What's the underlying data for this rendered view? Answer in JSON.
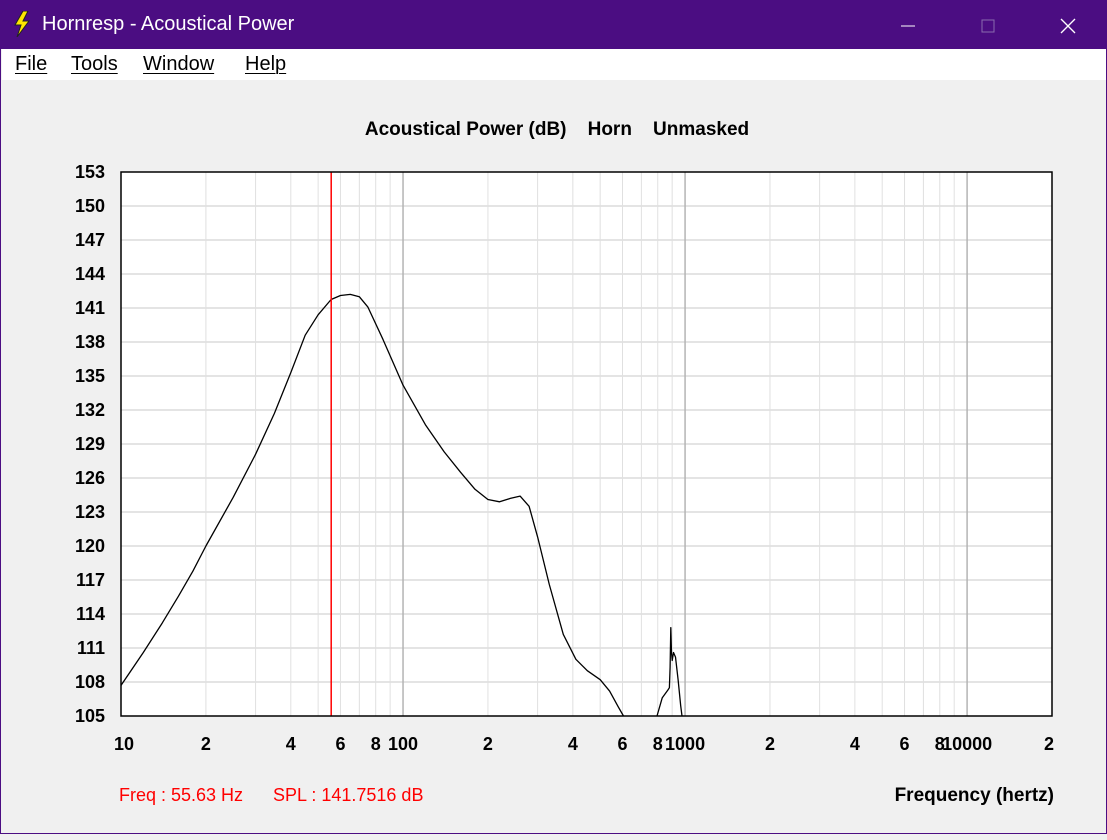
{
  "window": {
    "title": "Hornresp - Acoustical Power",
    "accent": "#4b0d82"
  },
  "menu": [
    "File",
    "Tools",
    "Window",
    "Help"
  ],
  "readout": {
    "freq": "Freq : 55.63 Hz",
    "spl": "SPL : 141.7516 dB",
    "color": "#ff0000"
  },
  "chart_data": {
    "type": "line",
    "title": "Acoustical Power (dB)    Horn    Unmasked",
    "xlabel": "Frequency (hertz)",
    "ylabel": "",
    "x_scale": "log",
    "xlim": [
      10,
      20000
    ],
    "ylim": [
      105,
      153
    ],
    "grid": true,
    "y_ticks": [
      153,
      150,
      147,
      144,
      141,
      138,
      135,
      132,
      129,
      126,
      123,
      120,
      117,
      114,
      111,
      108,
      105
    ],
    "x_ticks": [
      {
        "value": 10,
        "label": "10"
      },
      {
        "value": 20,
        "label": "2"
      },
      {
        "value": 40,
        "label": "4"
      },
      {
        "value": 60,
        "label": "6"
      },
      {
        "value": 80,
        "label": "8"
      },
      {
        "value": 100,
        "label": "100"
      },
      {
        "value": 200,
        "label": "2"
      },
      {
        "value": 400,
        "label": "4"
      },
      {
        "value": 600,
        "label": "6"
      },
      {
        "value": 800,
        "label": "8"
      },
      {
        "value": 1000,
        "label": "1000"
      },
      {
        "value": 2000,
        "label": "2"
      },
      {
        "value": 4000,
        "label": "4"
      },
      {
        "value": 6000,
        "label": "6"
      },
      {
        "value": 8000,
        "label": "8"
      },
      {
        "value": 10000,
        "label": "10000"
      },
      {
        "value": 20000,
        "label": "2"
      }
    ],
    "marker": {
      "x": 55.63,
      "color": "#ff0000"
    },
    "series": [
      {
        "color": "#000000",
        "segments": [
          [
            [
              10,
              107.7
            ],
            [
              12,
              110.6
            ],
            [
              14,
              113.2
            ],
            [
              16,
              115.6
            ],
            [
              18,
              117.8
            ],
            [
              20,
              120.0
            ],
            [
              25,
              124.3
            ],
            [
              30,
              128.1
            ],
            [
              35,
              131.7
            ],
            [
              40,
              135.3
            ],
            [
              45,
              138.6
            ],
            [
              50,
              140.4
            ],
            [
              55.6,
              141.75
            ],
            [
              60,
              142.1
            ],
            [
              65,
              142.2
            ],
            [
              70,
              142.0
            ],
            [
              75,
              141.1
            ],
            [
              85,
              138.2
            ],
            [
              100,
              134.2
            ],
            [
              120,
              130.7
            ],
            [
              140,
              128.3
            ],
            [
              160,
              126.5
            ],
            [
              180,
              125.0
            ],
            [
              200,
              124.1
            ],
            [
              220,
              123.9
            ],
            [
              240,
              124.2
            ],
            [
              260,
              124.4
            ],
            [
              280,
              123.5
            ],
            [
              300,
              120.8
            ],
            [
              330,
              116.6
            ],
            [
              370,
              112.2
            ],
            [
              410,
              110.0
            ],
            [
              450,
              109.0
            ],
            [
              500,
              108.2
            ],
            [
              540,
              107.2
            ],
            [
              580,
              105.8
            ],
            [
              605,
              105.0
            ]
          ],
          [
            [
              795,
              105.0
            ],
            [
              830,
              106.6
            ],
            [
              870,
              107.3
            ],
            [
              880,
              107.5
            ],
            [
              885,
              109.3
            ],
            [
              890,
              112.8
            ],
            [
              895,
              110.6
            ],
            [
              900,
              109.9
            ],
            [
              910,
              110.6
            ],
            [
              925,
              110.2
            ],
            [
              945,
              108.2
            ],
            [
              965,
              105.9
            ],
            [
              975,
              105.0
            ]
          ]
        ]
      }
    ]
  }
}
